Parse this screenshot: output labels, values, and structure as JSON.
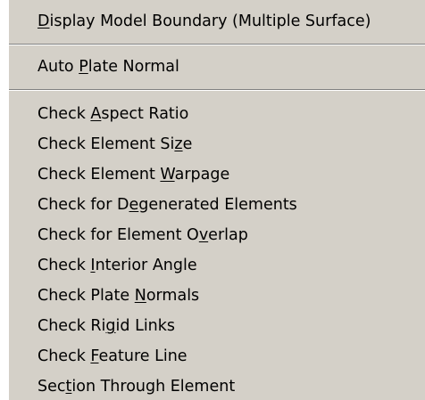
{
  "menu": {
    "groups": [
      {
        "items": [
          {
            "pre": "",
            "key": "D",
            "post": "isplay Model Boundary (Multiple Surface)"
          }
        ]
      },
      {
        "items": [
          {
            "pre": "Auto ",
            "key": "P",
            "post": "late Normal"
          }
        ]
      },
      {
        "items": [
          {
            "pre": "Check ",
            "key": "A",
            "post": "spect Ratio"
          },
          {
            "pre": "Check Element Si",
            "key": "z",
            "post": "e"
          },
          {
            "pre": "Check Element ",
            "key": "W",
            "post": "arpage"
          },
          {
            "pre": "Check for D",
            "key": "e",
            "post": "generated Elements"
          },
          {
            "pre": "Check for Element O",
            "key": "v",
            "post": "erlap"
          },
          {
            "pre": "Check ",
            "key": "I",
            "post": "nterior Angle"
          },
          {
            "pre": "Check Plate ",
            "key": "N",
            "post": "ormals"
          },
          {
            "pre": "Check Ri",
            "key": "g",
            "post": "id Links"
          },
          {
            "pre": "Check ",
            "key": "F",
            "post": "eature Line"
          },
          {
            "pre": "Sec",
            "key": "t",
            "post": "ion Through Element"
          }
        ]
      }
    ]
  }
}
